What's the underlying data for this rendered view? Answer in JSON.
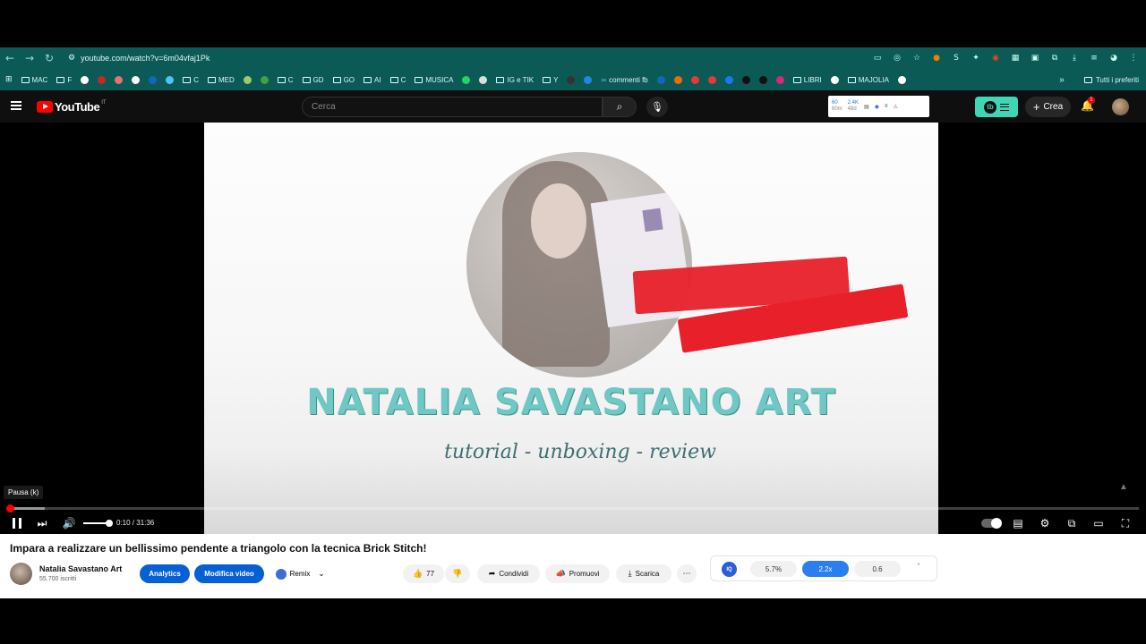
{
  "browser": {
    "url": "youtube.com/watch?v=6m04vfaj1Pk",
    "bookmarks": [
      {
        "label": "MAC",
        "type": "folder"
      },
      {
        "label": "F",
        "type": "folder"
      },
      {
        "label": "",
        "type": "dot",
        "color": "#ffffff"
      },
      {
        "label": "",
        "type": "dot",
        "color": "#c62828"
      },
      {
        "label": "",
        "type": "dot",
        "color": "#e57373"
      },
      {
        "label": "",
        "type": "dot",
        "color": "#ffffff"
      },
      {
        "label": "",
        "type": "dot",
        "color": "#1565c0"
      },
      {
        "label": "",
        "type": "dot",
        "color": "#4fc3f7"
      },
      {
        "label": "C",
        "type": "folder"
      },
      {
        "label": "MED",
        "type": "folder"
      },
      {
        "label": "",
        "type": "dot",
        "color": "#9ccc65"
      },
      {
        "label": "",
        "type": "dot",
        "color": "#43a047"
      },
      {
        "label": "C",
        "type": "folder"
      },
      {
        "label": "GD",
        "type": "folder"
      },
      {
        "label": "GO",
        "type": "folder"
      },
      {
        "label": "AI",
        "type": "folder"
      },
      {
        "label": "C",
        "type": "folder"
      },
      {
        "label": "MUSICA",
        "type": "folder"
      },
      {
        "label": "",
        "type": "dot",
        "color": "#25d366"
      },
      {
        "label": "",
        "type": "dot",
        "color": "#dddddd"
      },
      {
        "label": "IG e TIK",
        "type": "folder"
      },
      {
        "label": "Y",
        "type": "folder"
      },
      {
        "label": "",
        "type": "dot",
        "color": "#333333"
      },
      {
        "label": "",
        "type": "dot",
        "color": "#1e88e5"
      },
      {
        "label": "commenti fb",
        "type": "link"
      },
      {
        "label": "",
        "type": "dot",
        "color": "#1565c0"
      },
      {
        "label": "",
        "type": "dot",
        "color": "#ef6c00"
      },
      {
        "label": "",
        "type": "dot",
        "color": "#e53935"
      },
      {
        "label": "",
        "type": "dot",
        "color": "#e53935"
      },
      {
        "label": "",
        "type": "dot",
        "color": "#1877f2"
      },
      {
        "label": "",
        "type": "dot",
        "color": "#111111"
      },
      {
        "label": "",
        "type": "dot",
        "color": "#111111"
      },
      {
        "label": "",
        "type": "dot",
        "color": "#d62976"
      },
      {
        "label": "LIBRI",
        "type": "folder"
      },
      {
        "label": "",
        "type": "dot",
        "color": "#ffffff"
      },
      {
        "label": "MAJOLIA",
        "type": "folder"
      },
      {
        "label": "",
        "type": "dot",
        "color": "#ffffff"
      }
    ],
    "more_label": "»",
    "all_bookmarks": "Tutti i preferiti"
  },
  "header": {
    "logo_text": "YouTube",
    "logo_country": "IT",
    "search_placeholder": "Cerca",
    "extension": {
      "views": "60",
      "views_sub": "60m",
      "subs": "2.4K",
      "subs_sub": "48d"
    },
    "crea_label": "Crea",
    "notifications_count": "1"
  },
  "player": {
    "brand_title": "NATALIA SAVASTANO ART",
    "brand_subtitle": "tutorial - unboxing - review",
    "tooltip": "Pausa (k)",
    "time": "0:10 / 31:36",
    "progress_played_fraction": 0.005,
    "progress_buffered_fraction": 0.033,
    "volume_fraction": 1.0
  },
  "video": {
    "title": "Impara a realizzare un bellissimo pendente a triangolo con la tecnica Brick Stitch!",
    "channel_name": "Natalia Savastano Art",
    "channel_subs": "55.700 iscritti",
    "analytics_label": "Analytics",
    "edit_label": "Modifica video",
    "remix_label": "Remix",
    "likes": "77",
    "share_label": "Condividi",
    "promote_label": "Promuovi",
    "download_label": "Scarica"
  },
  "stats": {
    "badge": "IQ",
    "ctr": "5.7%",
    "multiplier": "2.2x",
    "score": "0.6"
  }
}
